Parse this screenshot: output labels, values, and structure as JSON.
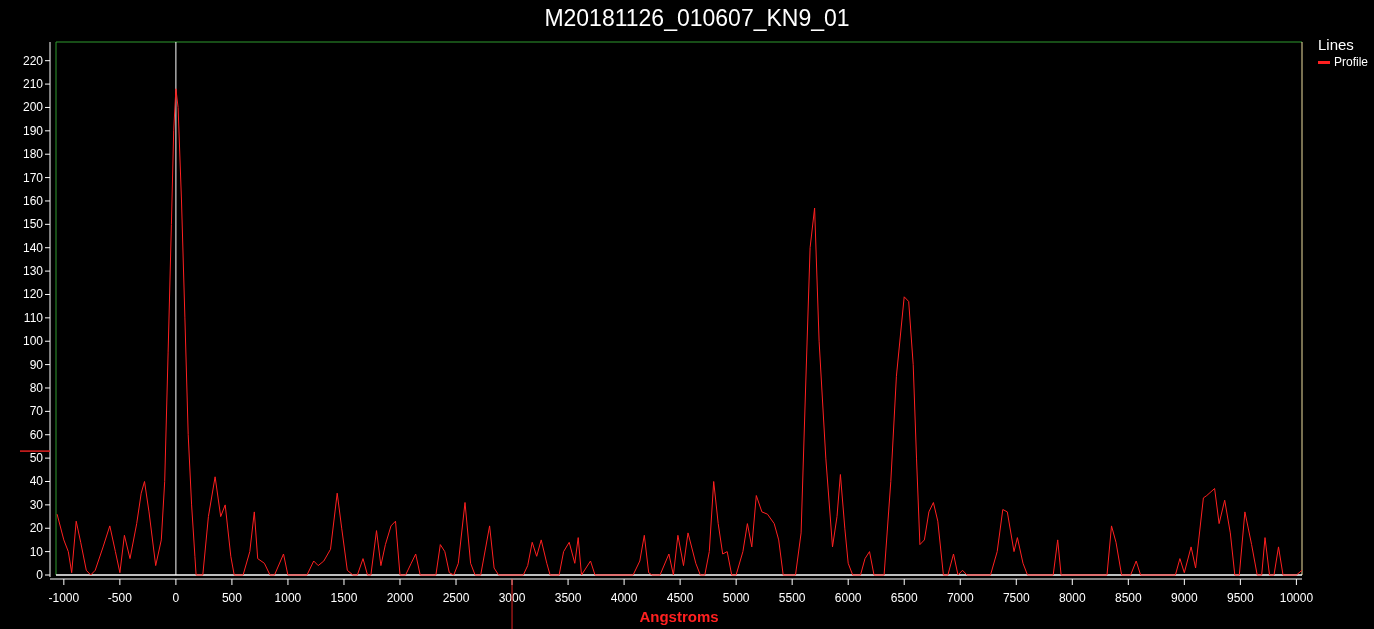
{
  "title": "M20181126_010607_KN9_01",
  "legend": {
    "title": "Lines"
  },
  "chart_data": {
    "type": "line",
    "xlabel": "Angstroms",
    "xlim": [
      -1070,
      10050
    ],
    "ylim": [
      0,
      228
    ],
    "xticks": [
      -1000,
      -500,
      0,
      500,
      1000,
      1500,
      2000,
      2500,
      3000,
      3500,
      4000,
      4500,
      5000,
      5500,
      6000,
      6500,
      7000,
      7500,
      8000,
      8500,
      9000,
      9500,
      10000
    ],
    "yticks": [
      0,
      10,
      20,
      30,
      40,
      50,
      60,
      70,
      80,
      90,
      100,
      110,
      120,
      130,
      140,
      150,
      160,
      170,
      180,
      190,
      200,
      210,
      220
    ],
    "x": [
      -1060,
      -1000,
      -960,
      -930,
      -890,
      -850,
      -800,
      -760,
      -720,
      -650,
      -590,
      -540,
      -500,
      -460,
      -410,
      -350,
      -310,
      -280,
      -240,
      -180,
      -130,
      -100,
      -70,
      -40,
      -20,
      0,
      20,
      50,
      80,
      110,
      140,
      170,
      180,
      240,
      290,
      350,
      400,
      440,
      490,
      520,
      600,
      660,
      700,
      730,
      790,
      840,
      880,
      960,
      1000,
      1170,
      1230,
      1270,
      1320,
      1380,
      1440,
      1480,
      1530,
      1580,
      1620,
      1670,
      1710,
      1740,
      1790,
      1830,
      1870,
      1920,
      1960,
      2000,
      2050,
      2100,
      2140,
      2180,
      2320,
      2360,
      2400,
      2440,
      2480,
      2520,
      2580,
      2630,
      2670,
      2720,
      2800,
      2840,
      2880,
      3100,
      3140,
      3180,
      3220,
      3260,
      3310,
      3340,
      3420,
      3460,
      3510,
      3560,
      3590,
      3620,
      3700,
      3740,
      4080,
      4140,
      4180,
      4220,
      4250,
      4320,
      4400,
      4440,
      4480,
      4530,
      4570,
      4640,
      4680,
      4720,
      4760,
      4800,
      4840,
      4880,
      4920,
      4960,
      5000,
      5060,
      5100,
      5140,
      5180,
      5230,
      5280,
      5340,
      5380,
      5420,
      5530,
      5580,
      5620,
      5660,
      5700,
      5740,
      5800,
      5860,
      5900,
      5930,
      5970,
      6000,
      6040,
      6110,
      6150,
      6190,
      6230,
      6320,
      6380,
      6430,
      6500,
      6540,
      6580,
      6610,
      6640,
      6680,
      6720,
      6760,
      6800,
      6850,
      6890,
      6940,
      6980,
      7020,
      7060,
      7270,
      7330,
      7380,
      7420,
      7480,
      7510,
      7560,
      7600,
      7830,
      7870,
      7900,
      8310,
      8350,
      8390,
      8440,
      8520,
      8570,
      8610,
      8920,
      8960,
      9000,
      9060,
      9100,
      9170,
      9200,
      9270,
      9310,
      9360,
      9410,
      9450,
      9490,
      9540,
      9600,
      9650,
      9690,
      9720,
      9760,
      9800,
      9840,
      9880,
      10000,
      10050
    ],
    "series": [
      {
        "name": "Profile",
        "color": "#ff2020",
        "values": [
          26,
          15,
          10,
          1,
          23,
          14,
          2,
          0,
          2,
          12,
          21,
          10,
          1,
          17,
          7,
          22,
          35,
          40,
          27,
          4,
          15,
          40,
          95,
          150,
          190,
          208,
          200,
          160,
          110,
          60,
          30,
          8,
          0,
          0,
          25,
          42,
          25,
          30,
          8,
          0,
          0,
          10,
          27,
          7,
          5,
          0,
          0,
          9,
          0,
          0,
          6,
          4,
          6,
          11,
          35,
          20,
          2,
          0,
          0,
          7,
          0,
          0,
          19,
          4,
          13,
          21,
          23,
          0,
          0,
          5,
          9,
          0,
          0,
          13,
          10,
          1,
          0,
          5,
          31,
          5,
          0,
          0,
          21,
          3,
          0,
          0,
          4,
          14,
          8,
          15,
          5,
          0,
          0,
          10,
          14,
          5,
          16,
          0,
          6,
          0,
          0,
          6,
          17,
          1,
          0,
          0,
          9,
          0,
          17,
          4,
          18,
          5,
          0,
          0,
          10,
          40,
          22,
          9,
          10,
          0,
          0,
          10,
          22,
          12,
          34,
          27,
          26,
          22,
          15,
          0,
          0,
          18,
          80,
          140,
          157,
          100,
          50,
          12,
          25,
          43,
          20,
          5,
          0,
          0,
          7,
          10,
          0,
          0,
          40,
          85,
          119,
          117,
          90,
          50,
          13,
          15,
          27,
          31,
          23,
          0,
          0,
          9,
          0,
          2,
          0,
          0,
          10,
          28,
          27,
          10,
          16,
          5,
          0,
          0,
          15,
          0,
          0,
          21,
          14,
          0,
          0,
          6,
          0,
          0,
          7,
          1,
          12,
          3,
          33,
          34,
          37,
          22,
          32,
          18,
          0,
          0,
          27,
          13,
          0,
          0,
          16,
          0,
          0,
          12,
          0,
          0,
          2
        ]
      }
    ]
  }
}
